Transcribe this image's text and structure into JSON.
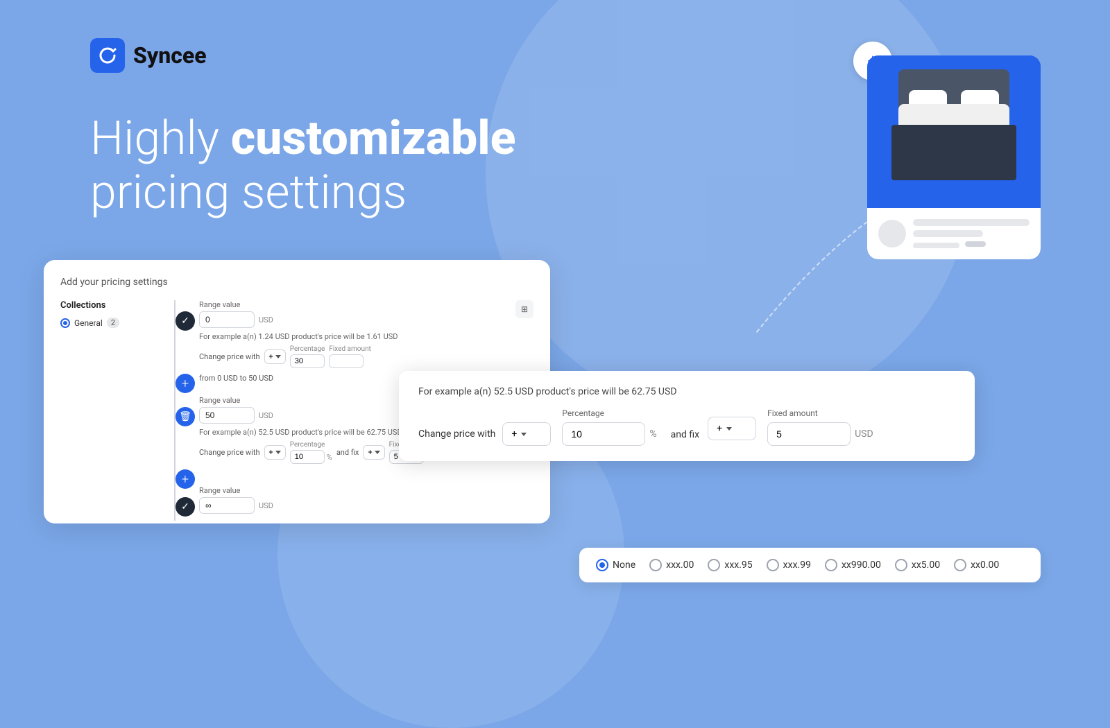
{
  "brand": {
    "name": "Syncee",
    "logo_alt": "Syncee logo"
  },
  "headline": {
    "line1_normal": "Highly ",
    "line1_bold": "customizable",
    "line2": "pricing settings"
  },
  "pricing_card": {
    "title": "Add your pricing settings",
    "collections_label": "Collections",
    "collection_item": "General",
    "collection_badge": "2",
    "rows": [
      {
        "range_label": "Range value",
        "range_value": "0",
        "currency": "USD",
        "type": "start"
      },
      {
        "example_text": "For example a(n) 1.24 USD product's price will be 1.61 USD",
        "change_label": "Change price with",
        "sign": "+",
        "percentage_label": "Percentage",
        "percentage_value": "30",
        "fixed_label": "Fixed amount",
        "from_to": "from 0 USD to 50 USD",
        "range_label": "Range value",
        "range_value": "50",
        "currency": "USD",
        "type": "middle"
      },
      {
        "example_text": "For example a(n) 52.5 USD product's price will be 62.75 USD",
        "change_label": "Change price with",
        "sign": "+",
        "percentage_label": "Percentage",
        "percentage_value": "10",
        "fixed_label": "Fixed amount",
        "fixed_value": "5",
        "currency": "USD",
        "type": "bottom"
      },
      {
        "range_label": "Range value",
        "range_value": "∞",
        "currency": "USD",
        "type": "end"
      }
    ]
  },
  "large_popup": {
    "example_text": "For example a(n) 52.5 USD product's price will be 62.75 USD",
    "change_label": "Change price with",
    "sign_value": "+",
    "percentage_label": "Percentage",
    "percentage_value": "10",
    "percentage_unit": "%",
    "and_fix_label": "and fix",
    "fixed_label": "Fixed amount",
    "fixed_value": "5",
    "fixed_unit": "USD"
  },
  "radio_options": {
    "options": [
      {
        "label": "None",
        "selected": true
      },
      {
        "label": "xxx.00",
        "selected": false
      },
      {
        "label": "xxx.95",
        "selected": false
      },
      {
        "label": "xxx.99",
        "selected": false
      },
      {
        "label": "xx990.00",
        "selected": false
      },
      {
        "label": "xx5.00",
        "selected": false
      },
      {
        "label": "xx0.00",
        "selected": false
      }
    ]
  },
  "product_card": {
    "add_button_label": "+",
    "image_alt": "Bed product"
  }
}
